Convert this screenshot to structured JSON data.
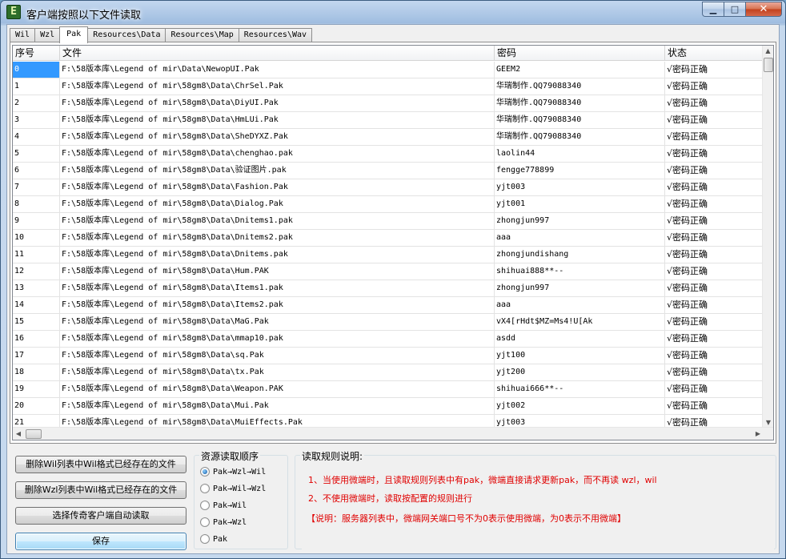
{
  "window": {
    "title": "客户端按照以下文件读取",
    "icon_letter": "E",
    "minimize_glyph": "▁",
    "maximize_glyph": "□",
    "close_glyph": "✕"
  },
  "tabs": [
    {
      "label": "Wil",
      "active": false
    },
    {
      "label": "Wzl",
      "active": false
    },
    {
      "label": "Pak",
      "active": true
    },
    {
      "label": "Resources\\Data",
      "active": false
    },
    {
      "label": "Resources\\Map",
      "active": false
    },
    {
      "label": "Resources\\Wav",
      "active": false
    }
  ],
  "table": {
    "columns": [
      "序号",
      "文件",
      "密码",
      "状态"
    ],
    "rows": [
      [
        "0",
        "F:\\58版本库\\Legend of mir\\Data\\NewopUI.Pak",
        "GEEM2",
        "√密码正确"
      ],
      [
        "1",
        "F:\\58版本库\\Legend of mir\\58gm8\\Data\\ChrSel.Pak",
        "华瑞制作.QQ79088340",
        "√密码正确"
      ],
      [
        "2",
        "F:\\58版本库\\Legend of mir\\58gm8\\Data\\DiyUI.Pak",
        "华瑞制作.QQ79088340",
        "√密码正确"
      ],
      [
        "3",
        "F:\\58版本库\\Legend of mir\\58gm8\\Data\\HmLUi.Pak",
        "华瑞制作.QQ79088340",
        "√密码正确"
      ],
      [
        "4",
        "F:\\58版本库\\Legend of mir\\58gm8\\Data\\SheDYXZ.Pak",
        "华瑞制作.QQ79088340",
        "√密码正确"
      ],
      [
        "5",
        "F:\\58版本库\\Legend of mir\\58gm8\\Data\\chenghao.pak",
        "laolin44",
        "√密码正确"
      ],
      [
        "6",
        "F:\\58版本库\\Legend of mir\\58gm8\\Data\\验证图片.pak",
        "fengge778899",
        "√密码正确"
      ],
      [
        "7",
        "F:\\58版本库\\Legend of mir\\58gm8\\Data\\Fashion.Pak",
        "yjt003",
        "√密码正确"
      ],
      [
        "8",
        "F:\\58版本库\\Legend of mir\\58gm8\\Data\\Dialog.Pak",
        "yjt001",
        "√密码正确"
      ],
      [
        "9",
        "F:\\58版本库\\Legend of mir\\58gm8\\Data\\Dnitems1.pak",
        "zhongjun997",
        "√密码正确"
      ],
      [
        "10",
        "F:\\58版本库\\Legend of mir\\58gm8\\Data\\Dnitems2.pak",
        "aaa",
        "√密码正确"
      ],
      [
        "11",
        "F:\\58版本库\\Legend of mir\\58gm8\\Data\\Dnitems.pak",
        "zhongjundishang",
        "√密码正确"
      ],
      [
        "12",
        "F:\\58版本库\\Legend of mir\\58gm8\\Data\\Hum.PAK",
        "shihuai888**--",
        "√密码正确"
      ],
      [
        "13",
        "F:\\58版本库\\Legend of mir\\58gm8\\Data\\Items1.pak",
        "zhongjun997",
        "√密码正确"
      ],
      [
        "14",
        "F:\\58版本库\\Legend of mir\\58gm8\\Data\\Items2.pak",
        "aaa",
        "√密码正确"
      ],
      [
        "15",
        "F:\\58版本库\\Legend of mir\\58gm8\\Data\\MaG.Pak",
        "vX4[rHdt$MZ=Ms4!U[Ak",
        "√密码正确"
      ],
      [
        "16",
        "F:\\58版本库\\Legend of mir\\58gm8\\Data\\mmap10.pak",
        "asdd",
        "√密码正确"
      ],
      [
        "17",
        "F:\\58版本库\\Legend of mir\\58gm8\\Data\\sq.Pak",
        "yjt100",
        "√密码正确"
      ],
      [
        "18",
        "F:\\58版本库\\Legend of mir\\58gm8\\Data\\tx.Pak",
        "yjt200",
        "√密码正确"
      ],
      [
        "19",
        "F:\\58版本库\\Legend of mir\\58gm8\\Data\\Weapon.PAK",
        "shihuai666**--",
        "√密码正确"
      ],
      [
        "20",
        "F:\\58版本库\\Legend of mir\\58gm8\\Data\\Mui.Pak",
        "yjt002",
        "√密码正确"
      ],
      [
        "21",
        "F:\\58版本库\\Legend of mir\\58gm8\\Data\\MuiEffects.Pak",
        "yjt003",
        "√密码正确"
      ]
    ],
    "selected_row": 0
  },
  "scroll": {
    "up": "▲",
    "down": "▼",
    "left": "◀",
    "right": "▶"
  },
  "buttons": {
    "delete_wil": "删除Wil列表中Wil格式已经存在的文件",
    "delete_wzl": "删除Wzl列表中Wil格式已经存在的文件",
    "choose_client": "选择传奇客户端自动读取",
    "save": "保存"
  },
  "order_group": {
    "title": "资源读取顺序",
    "options": [
      {
        "label": "Pak→Wzl→Wil",
        "checked": true
      },
      {
        "label": "Pak→Wil→Wzl",
        "checked": false
      },
      {
        "label": "Pak→Wil",
        "checked": false
      },
      {
        "label": "Pak→Wzl",
        "checked": false
      },
      {
        "label": "Pak",
        "checked": false
      }
    ]
  },
  "rules_group": {
    "title": "读取规则说明:",
    "lines": [
      "1、当使用微端时，且读取规则列表中有pak，微端直接请求更新pak，而不再读 wzl，wil",
      "2、不使用微端时，读取按配置的规则进行",
      "【说明：服务器列表中，微端网关端口号不为0表示使用微端，为0表示不用微端】"
    ]
  }
}
